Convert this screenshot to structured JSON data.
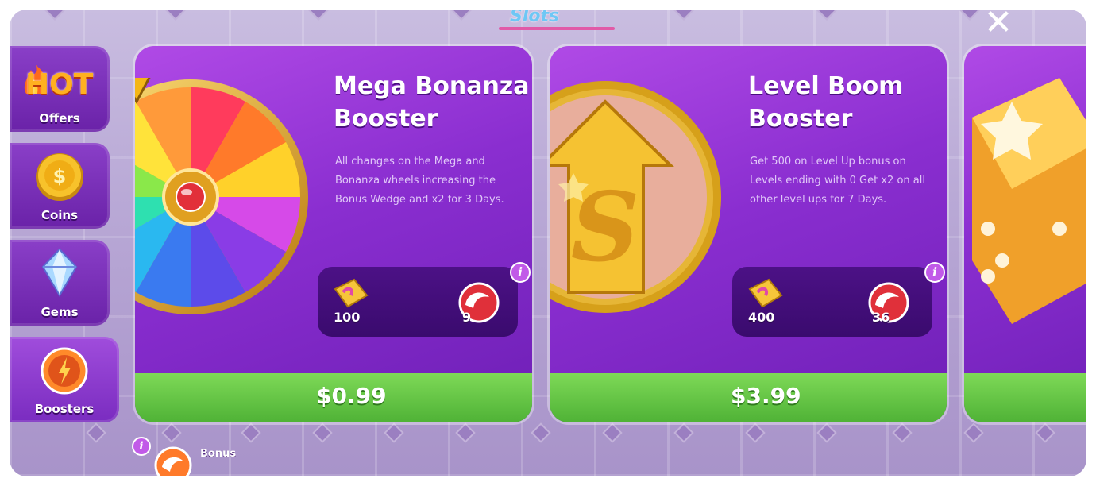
{
  "header": {
    "logo_text": "Slots",
    "close_label": "✕"
  },
  "sidebar": {
    "items": [
      {
        "label": "Offers",
        "badge": "HOT",
        "icon": "hot-offers-icon"
      },
      {
        "label": "Coins",
        "icon": "coin-icon"
      },
      {
        "label": "Gems",
        "icon": "gem-icon"
      },
      {
        "label": "Boosters",
        "icon": "booster-icon",
        "active": true
      }
    ]
  },
  "cards": [
    {
      "title_line1": "Mega Bonanza",
      "title_line2": "Booster",
      "description": "All changes on the Mega and Bonanza wheels increasing the Bonus Wedge and x2 for 3 Days.",
      "reward_ticket": "100",
      "reward_spins": "9",
      "price": "$0.99"
    },
    {
      "title_line1": "Level Boom",
      "title_line2": "Booster",
      "description": "Get 500 on Level Up bonus on Levels ending with 0 Get x2 on all other level ups for 7 Days.",
      "reward_ticket": "400",
      "reward_spins": "36",
      "price": "$3.99"
    }
  ],
  "footer": {
    "bonus_label": "Bonus"
  },
  "colors": {
    "card_purple": "#8a2ed0",
    "price_green": "#5fc23f",
    "gold": "#f2b81e"
  }
}
